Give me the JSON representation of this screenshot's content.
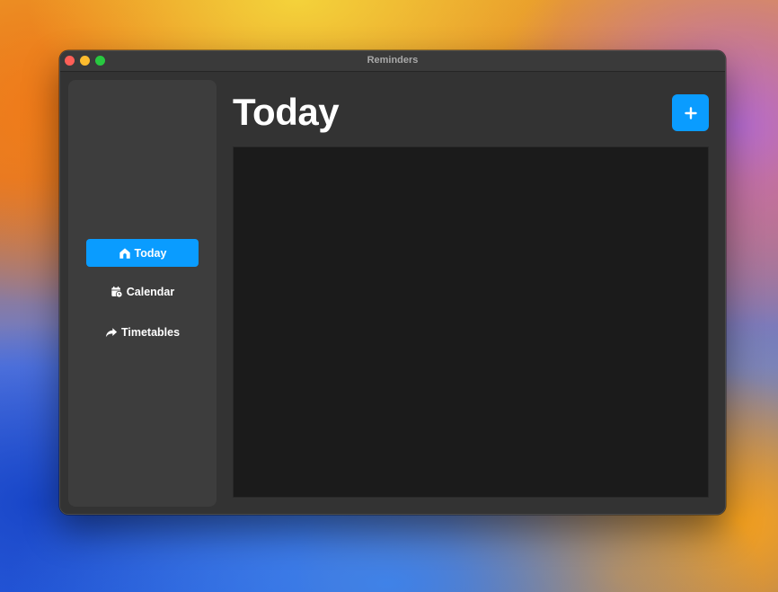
{
  "window": {
    "title": "Reminders"
  },
  "sidebar": {
    "items": [
      {
        "label": "Today",
        "icon": "house-icon",
        "active": true
      },
      {
        "label": "Calendar",
        "icon": "calendar-clock-icon",
        "active": false
      },
      {
        "label": "Timetables",
        "icon": "share-arrow-icon",
        "active": false
      }
    ]
  },
  "main": {
    "title": "Today",
    "add_button_icon": "plus-icon"
  },
  "colors": {
    "accent": "#0a9cff",
    "window_bg": "#333333",
    "sidebar_bg": "#3d3d3d",
    "content_bg": "#1b1b1b"
  }
}
